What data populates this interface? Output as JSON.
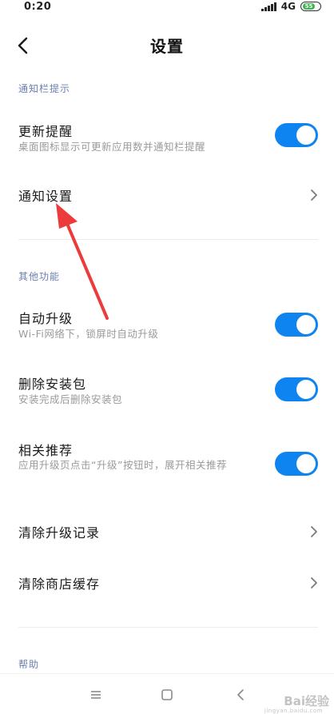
{
  "status_bar": {
    "time": "0:20",
    "network": "4G",
    "battery": "55"
  },
  "header": {
    "title": "设置"
  },
  "sections": {
    "notification": {
      "header": "通知栏提示",
      "update_reminder": {
        "title": "更新提醒",
        "subtitle": "桌面图标显示可更新应用数并通知栏提醒",
        "enabled": true
      },
      "notification_settings": {
        "title": "通知设置"
      }
    },
    "other": {
      "header": "其他功能",
      "auto_upgrade": {
        "title": "自动升级",
        "subtitle": "Wi-Fi网络下，锁屏时自动升级",
        "enabled": true
      },
      "delete_package": {
        "title": "删除安装包",
        "subtitle": "安装完成后删除安装包",
        "enabled": true
      },
      "related_recommend": {
        "title": "相关推荐",
        "subtitle": "应用升级页点击“升级”按钮时，展开相关推荐",
        "enabled": true
      },
      "clear_upgrade_records": {
        "title": "清除升级记录"
      },
      "clear_store_cache": {
        "title": "清除商店缓存"
      }
    },
    "help": {
      "header": "帮助"
    }
  },
  "colors": {
    "accent": "#0d84f0",
    "section_header": "#6a7fb0",
    "annotation_arrow": "#ec3b3b"
  },
  "watermark": {
    "text": "Bai经验",
    "url": "jingyan.baidu.com"
  }
}
